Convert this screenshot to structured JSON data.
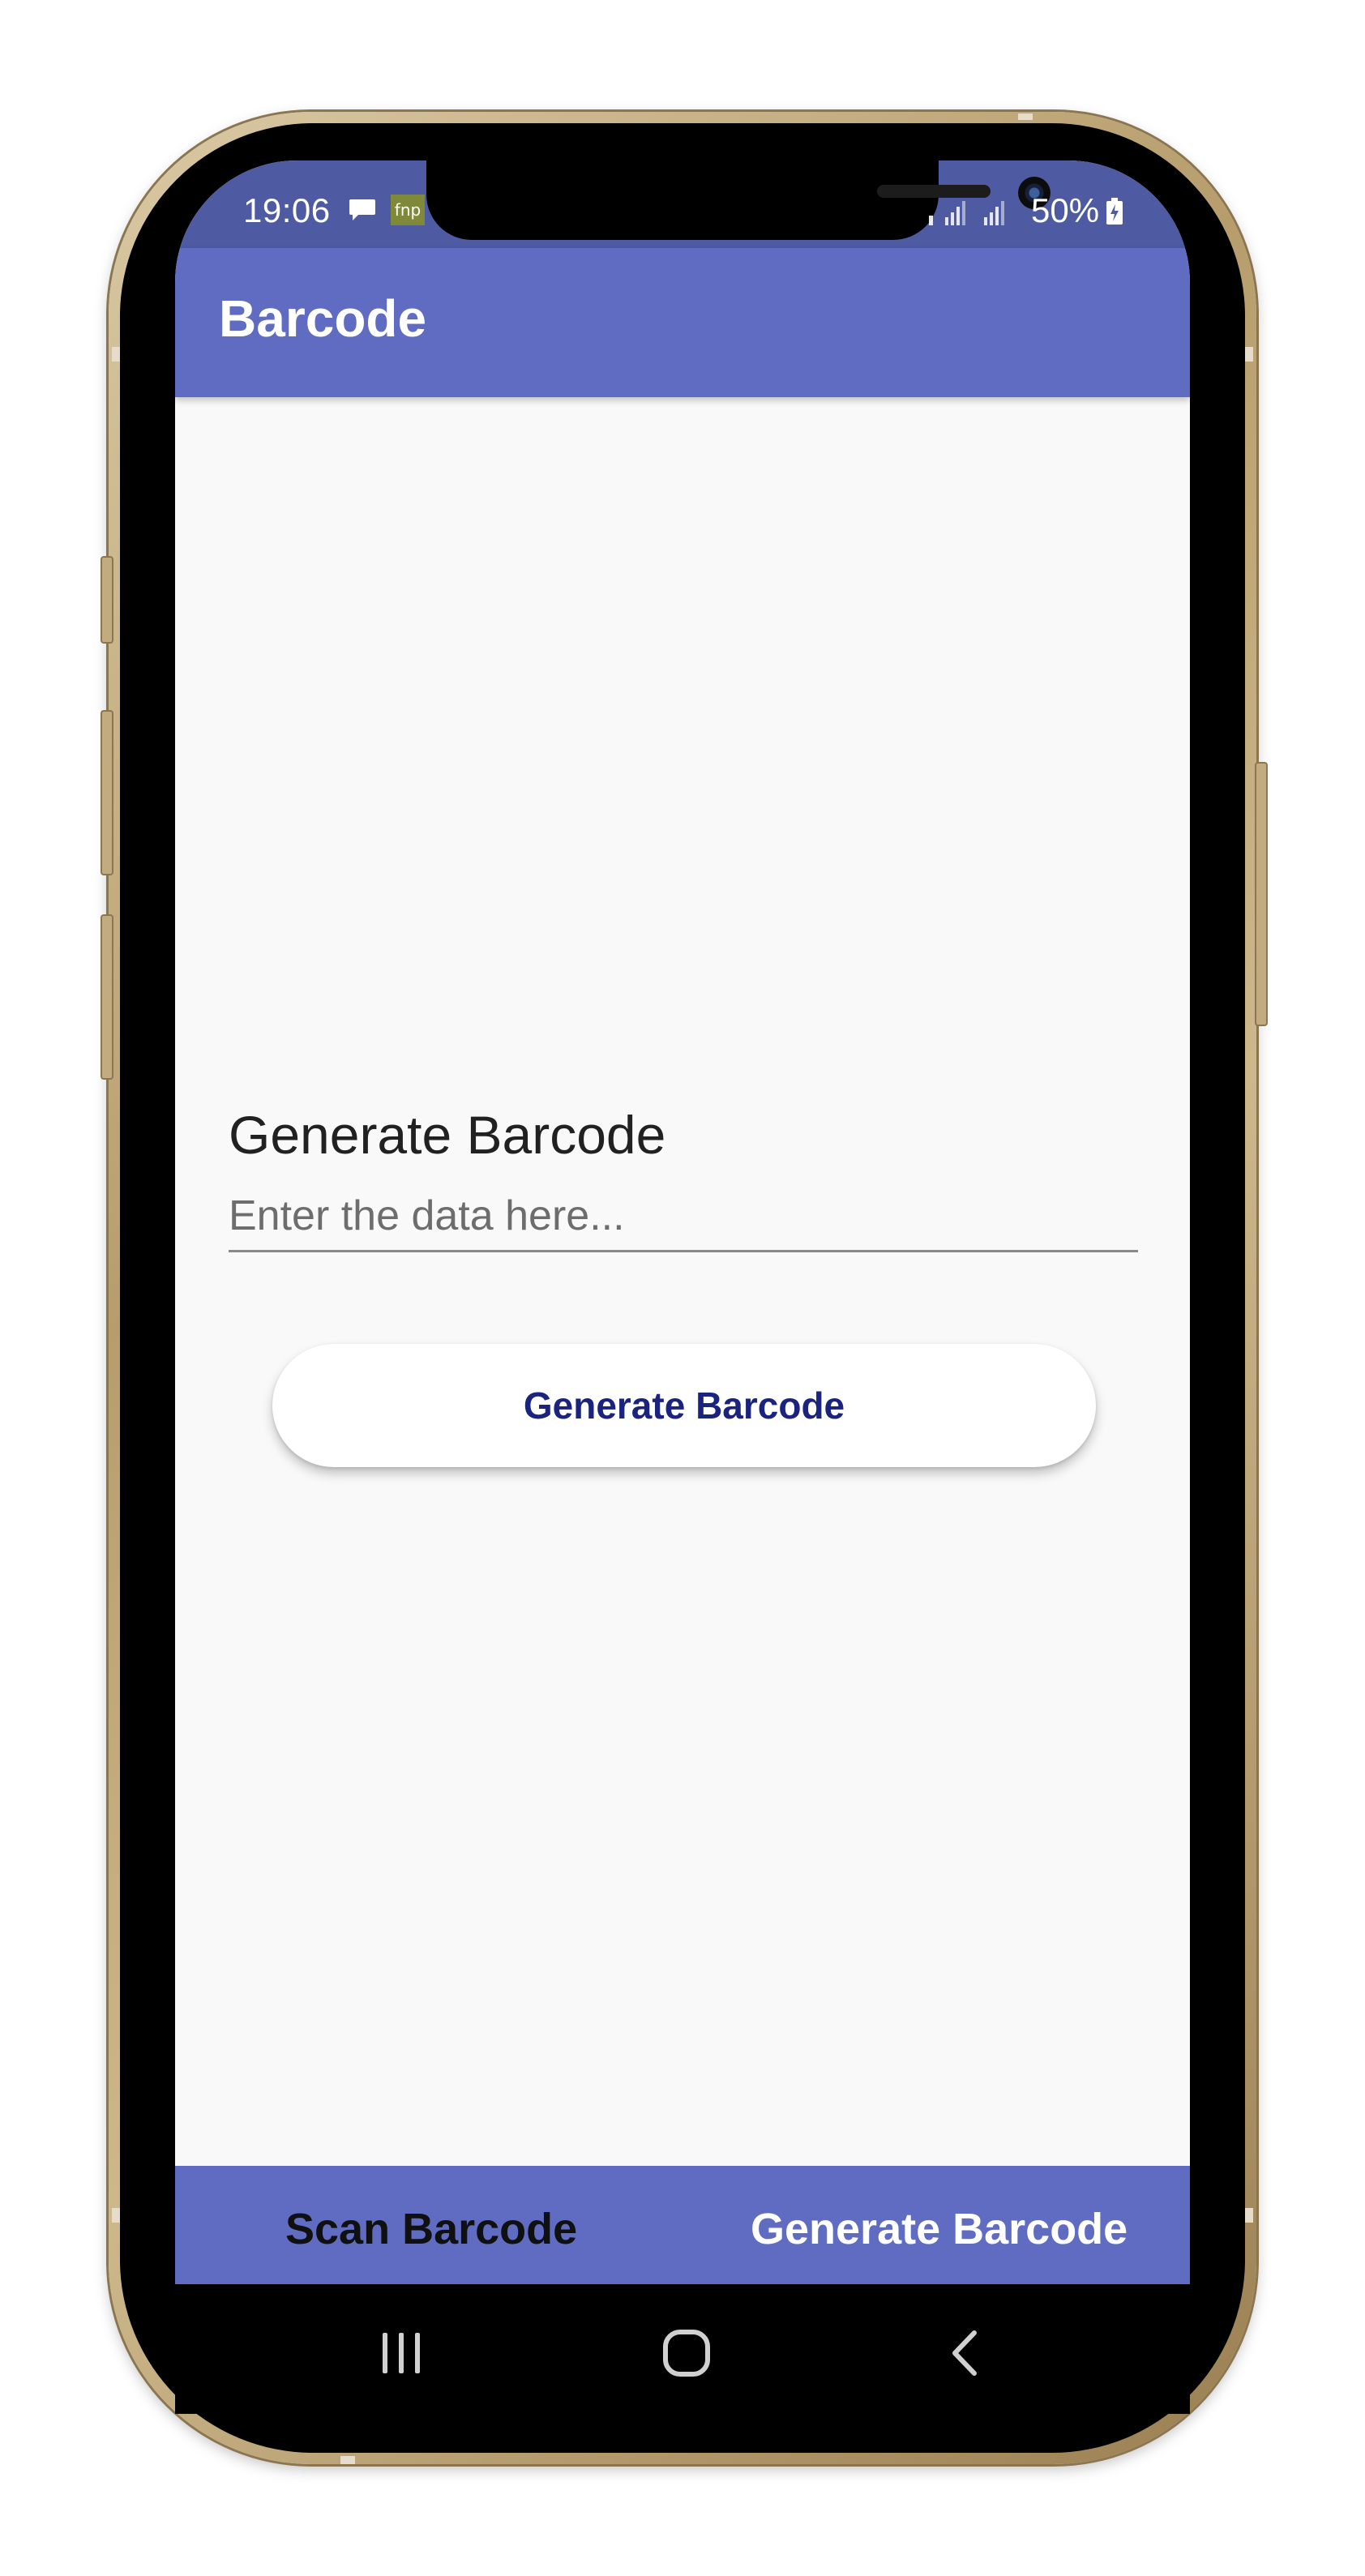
{
  "status_bar": {
    "time": "19:06",
    "notification_badge": "fnp",
    "battery": "50%",
    "icons": [
      "message-icon",
      "fnp-app-icon",
      "signal-icon",
      "battery-charging-icon"
    ]
  },
  "app_bar": {
    "title": "Barcode"
  },
  "generate_section": {
    "title": "Generate Barcode",
    "input_placeholder": "Enter the data here...",
    "input_value": "",
    "button_label": "Generate Barcode"
  },
  "bottom_nav": {
    "items": [
      {
        "label": "Scan Barcode",
        "active": false
      },
      {
        "label": "Generate Barcode",
        "active": true
      }
    ]
  },
  "system_nav": {
    "icons": [
      "recents-icon",
      "home-icon",
      "back-icon"
    ]
  },
  "colors": {
    "app_bar": "#5f6cc1",
    "status_bar": "#4e5ba3",
    "button_text": "#1a237e",
    "background": "#f9f9f9"
  }
}
